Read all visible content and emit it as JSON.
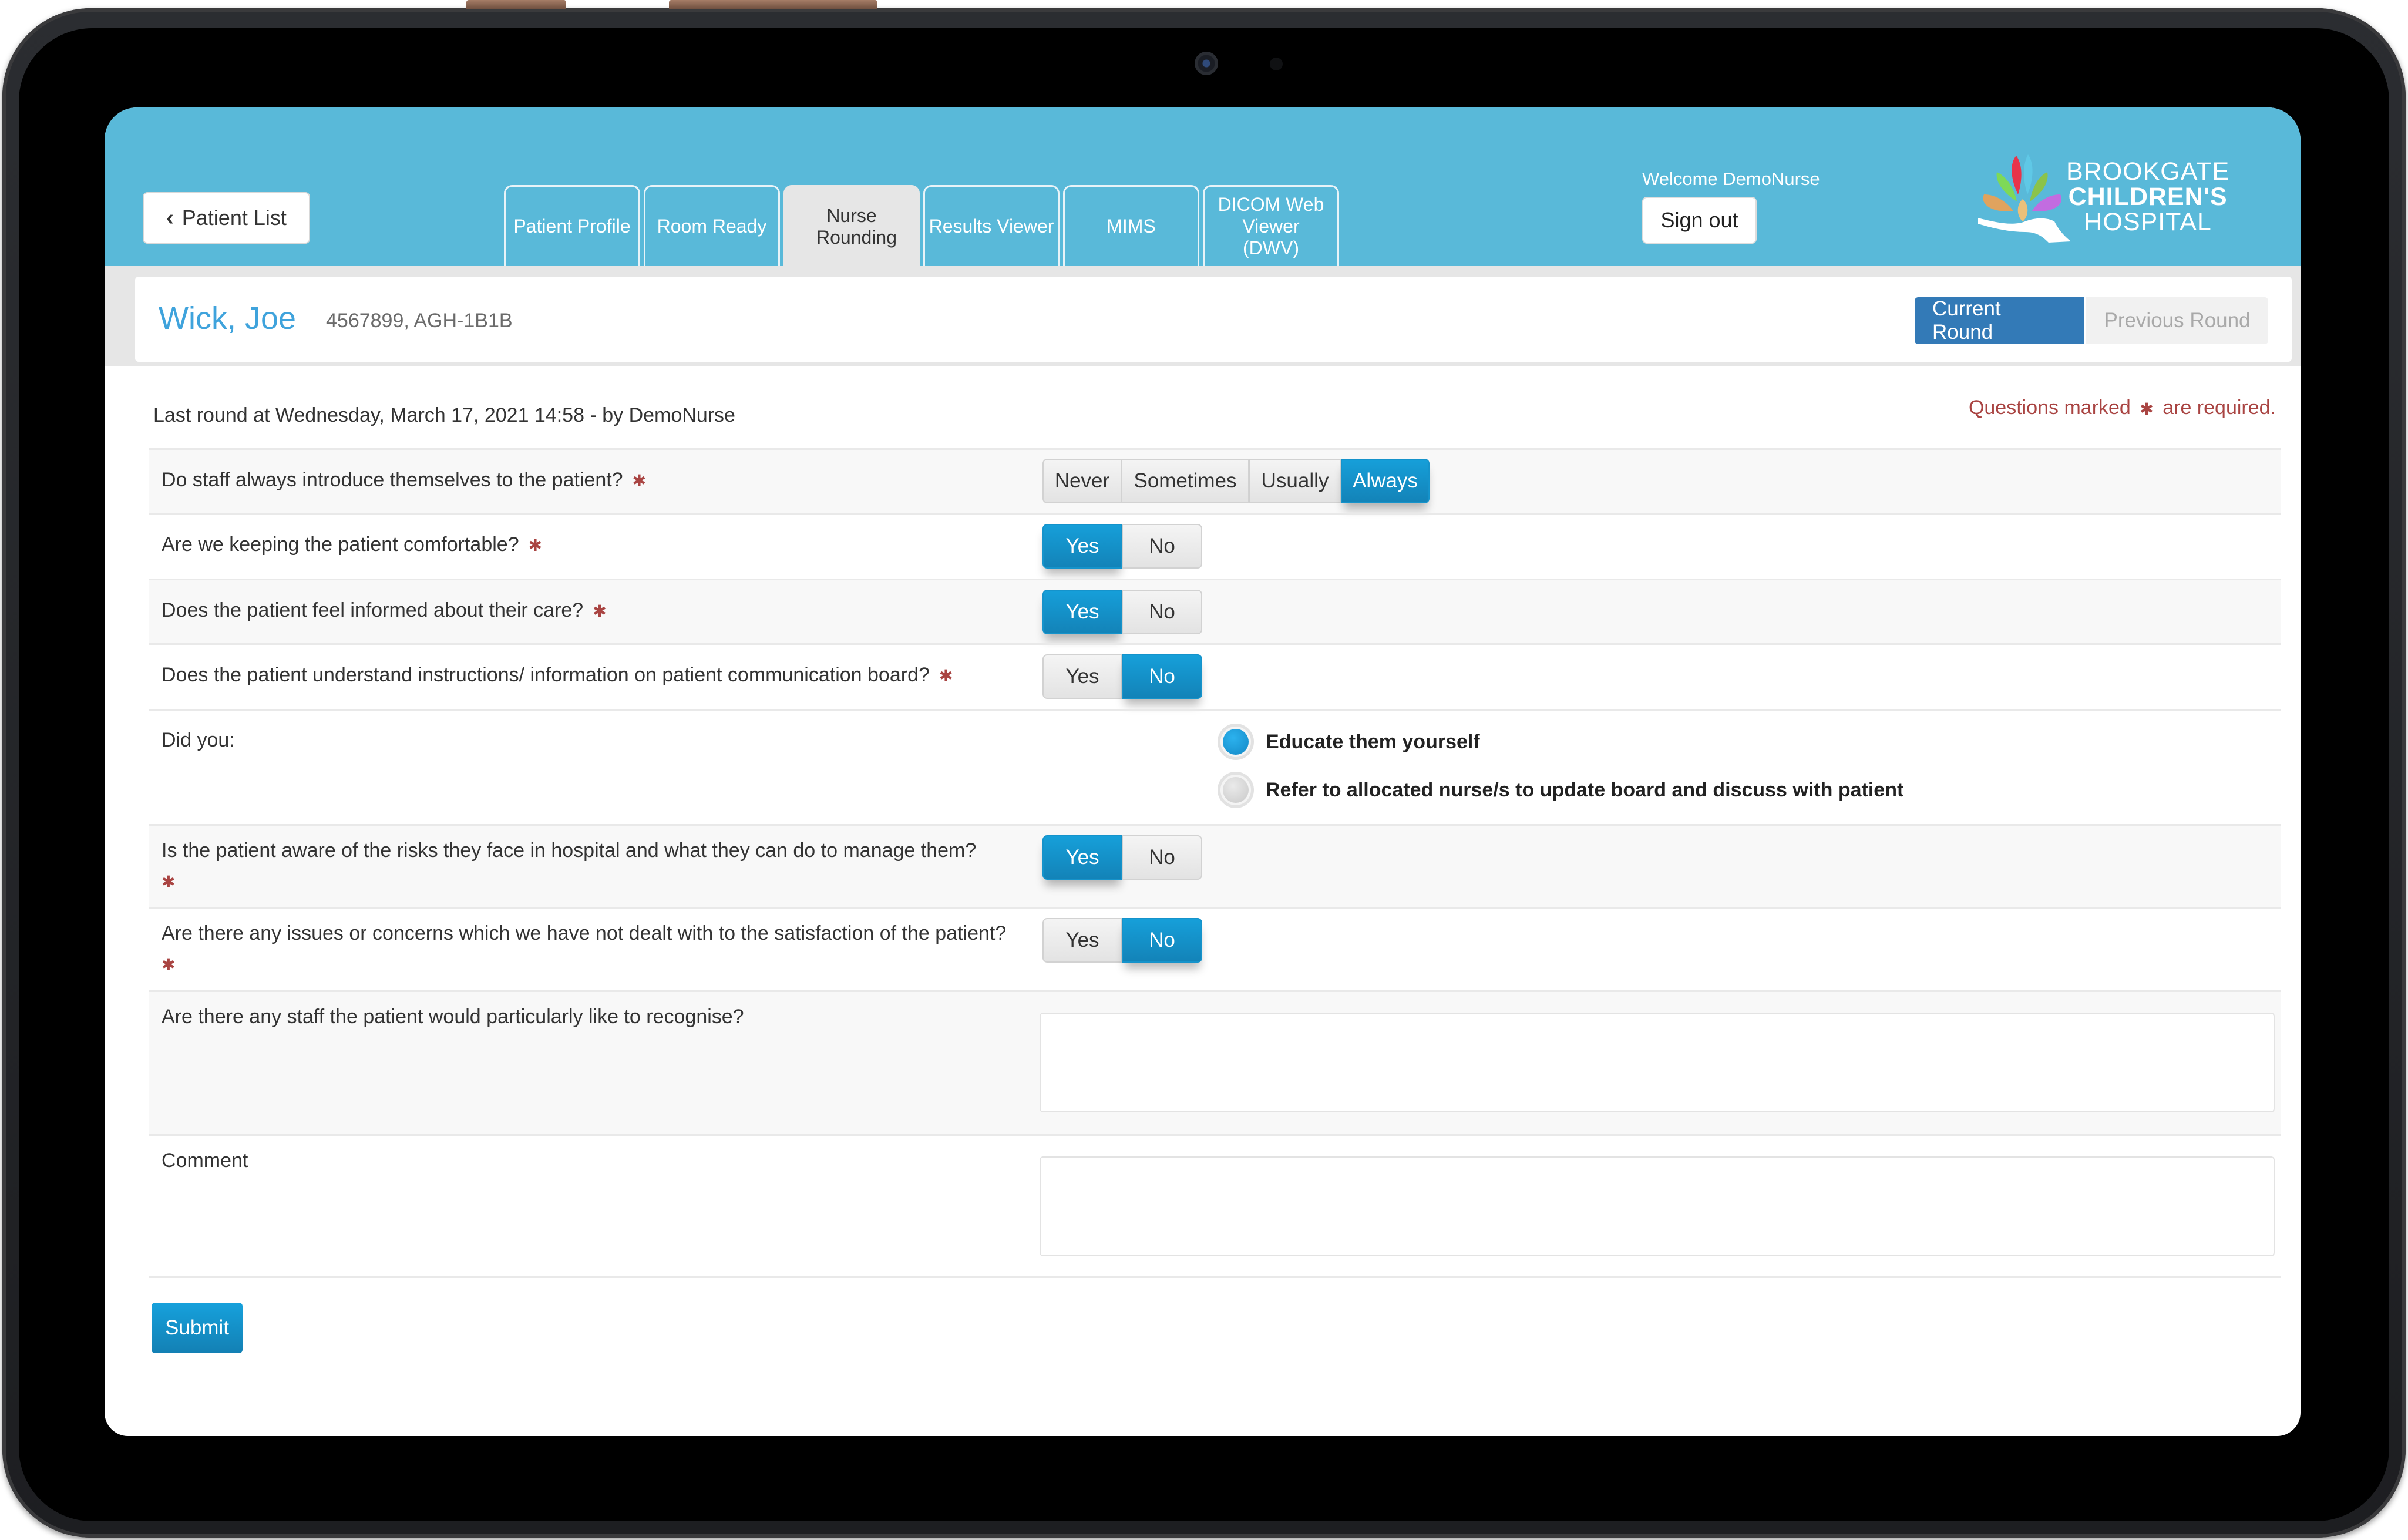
{
  "header": {
    "back_button": "Patient List",
    "tabs": [
      {
        "label": "Patient Profile",
        "active": false
      },
      {
        "label": "Room Ready",
        "active": false
      },
      {
        "label": "Nurse Rounding",
        "active": true
      },
      {
        "label": "Results Viewer",
        "active": false
      },
      {
        "label": "MIMS",
        "active": false
      },
      {
        "label": "DICOM Web Viewer (DWV)",
        "active": false
      }
    ],
    "welcome": "Welcome DemoNurse",
    "sign_out": "Sign out",
    "logo": {
      "line1": "BROOKGATE",
      "line2": "CHILDREN'S",
      "line3": "HOSPITAL",
      "petal_colors": [
        "#e8344a",
        "#5fc8e6",
        "#7ed957",
        "#8bc34a",
        "#e0a35e",
        "#ebc07a",
        "#c26ce0"
      ]
    }
  },
  "patient": {
    "name": "Wick, Joe",
    "identifier": "4567899, AGH-1B1B",
    "round_buttons": {
      "current": "Current Round",
      "previous": "Previous Round",
      "selected": "current"
    }
  },
  "form": {
    "last_round": "Last round at Wednesday, March 17, 2021 14:58 - by DemoNurse",
    "required_note_prefix": "Questions marked",
    "required_note_suffix": "are required.",
    "required_marker": "✱",
    "questions": [
      {
        "text": "Do staff always introduce themselves to the patient?",
        "required": true,
        "type": "choice",
        "options": [
          "Never",
          "Sometimes",
          "Usually",
          "Always"
        ],
        "selected": "Always"
      },
      {
        "text": "Are we keeping the patient comfortable?",
        "required": true,
        "type": "yesno",
        "options": [
          "Yes",
          "No"
        ],
        "selected": "Yes"
      },
      {
        "text": "Does the patient feel informed about their care?",
        "required": true,
        "type": "yesno",
        "options": [
          "Yes",
          "No"
        ],
        "selected": "Yes"
      },
      {
        "text": "Does the patient understand instructions/ information on patient communication board?",
        "required": true,
        "type": "yesno",
        "options": [
          "Yes",
          "No"
        ],
        "selected": "No"
      },
      {
        "text": "Did you:",
        "required": false,
        "type": "radio",
        "options": [
          "Educate them yourself",
          "Refer to allocated nurse/s to update board and discuss with patient"
        ],
        "selected": "Educate them yourself"
      },
      {
        "text": "Is the patient aware of the risks they face in hospital and what they can do to manage them?",
        "required": true,
        "type": "yesno",
        "options": [
          "Yes",
          "No"
        ],
        "selected": "Yes"
      },
      {
        "text": "Are there any issues or concerns which we have not dealt with to the satisfaction of the patient?",
        "required": true,
        "type": "yesno",
        "options": [
          "Yes",
          "No"
        ],
        "selected": "No"
      },
      {
        "text": "Are there any staff the patient would particularly like to recognise?",
        "required": false,
        "type": "text",
        "value": ""
      },
      {
        "text": "Comment",
        "required": false,
        "type": "text",
        "value": ""
      }
    ],
    "submit": "Submit"
  },
  "colors": {
    "header_bg": "#59b9d9",
    "accent": "#1593cb",
    "current_round": "#337ab7",
    "required": "#a94442",
    "patient_name": "#3fa3dc"
  }
}
